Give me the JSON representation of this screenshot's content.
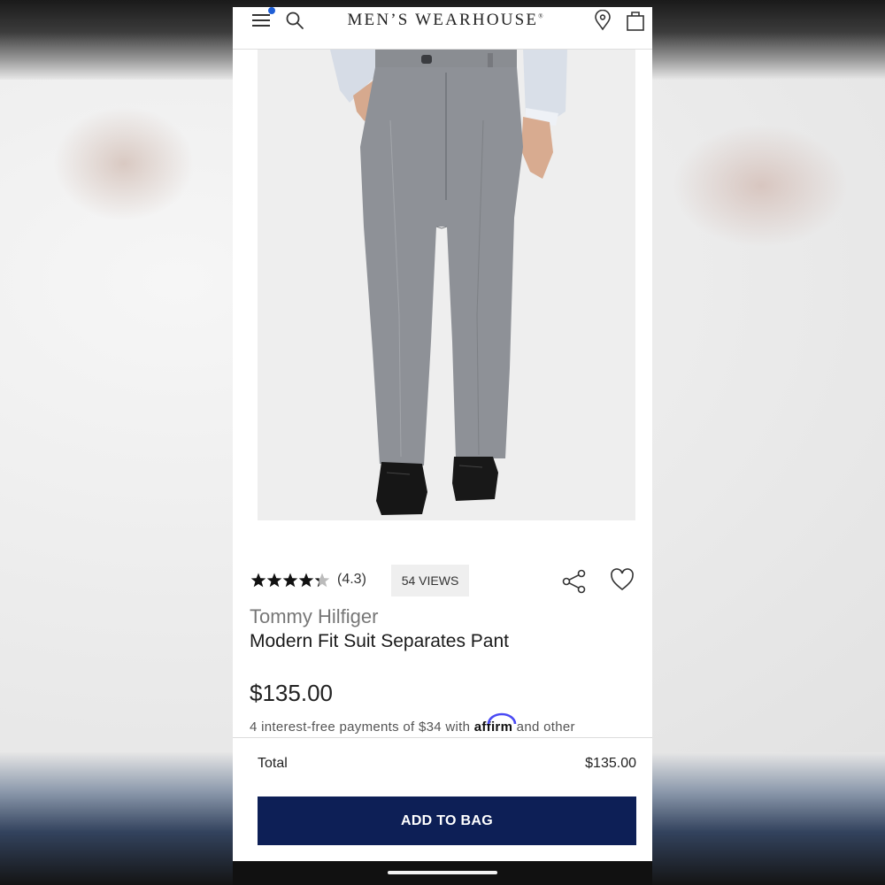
{
  "header": {
    "brand": "MEN’S WEARHOUSE",
    "registered_mark": "®"
  },
  "product": {
    "rating": 4.3,
    "rating_label": "(4.3)",
    "views": "54 VIEWS",
    "brand": "Tommy Hilfiger",
    "name": "Modern Fit Suit Separates Pant",
    "price": "$135.00",
    "installments_prefix": "4 interest-free payments of $34 with ",
    "affirm": "affirm",
    "installments_suffix": " and other",
    "image_icon": "product-photo-gray-pants"
  },
  "footer": {
    "total_label": "Total",
    "total_value": "$135.00",
    "cta": "ADD TO BAG"
  },
  "colors": {
    "cta_background": "#0d1f56",
    "notification_dot": "#1f5fd6",
    "affirm_arc": "#4a4af4"
  },
  "icons": [
    "menu-icon",
    "search-icon",
    "location-pin-icon",
    "shopping-bag-icon",
    "share-icon",
    "heart-icon",
    "star-icon"
  ]
}
